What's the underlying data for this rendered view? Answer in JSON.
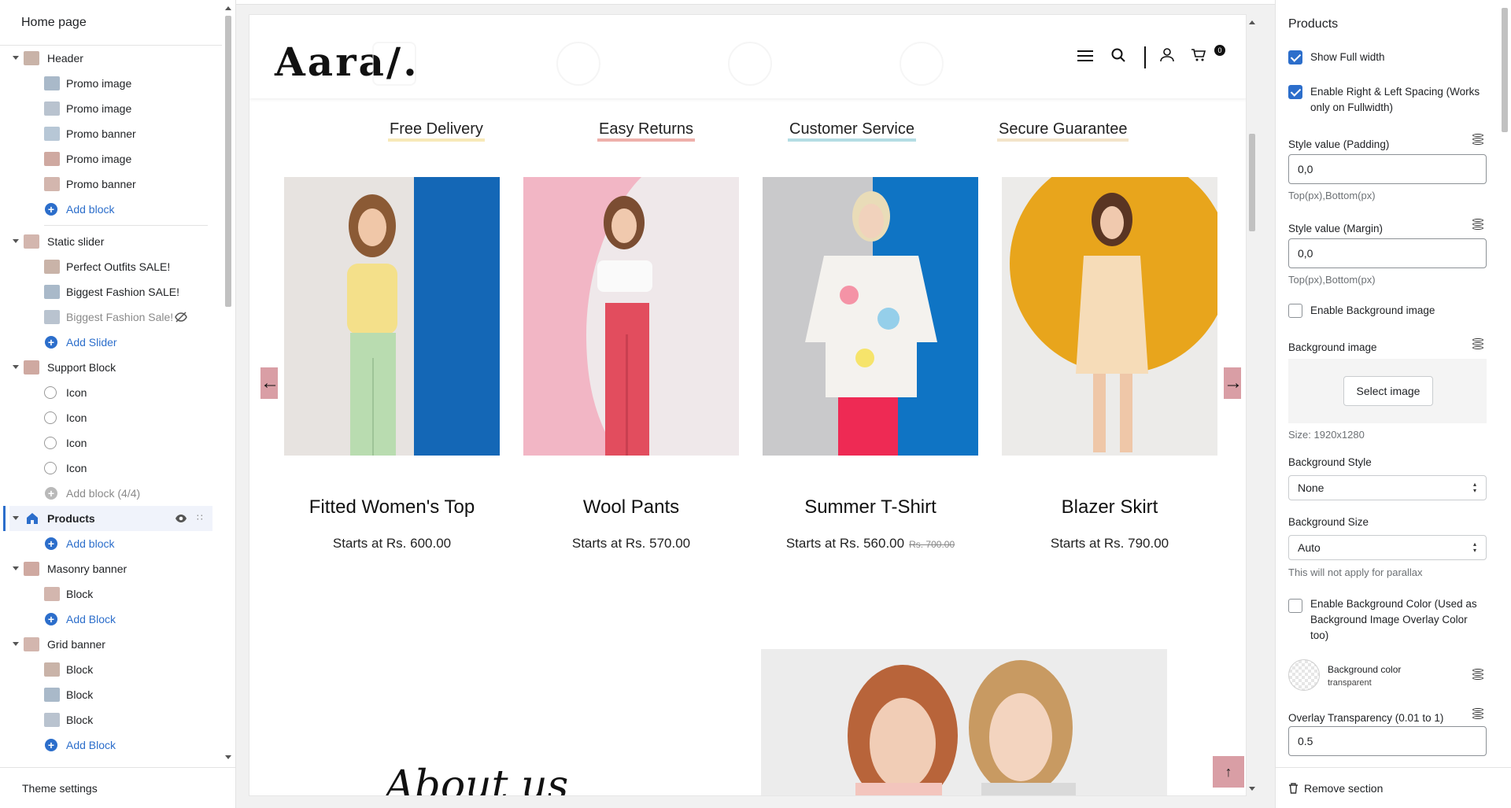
{
  "left_panel": {
    "title": "Home page",
    "footer": "Theme settings",
    "tree": [
      {
        "label": "Header",
        "type": "section"
      },
      {
        "label": "Promo image",
        "type": "child"
      },
      {
        "label": "Promo image",
        "type": "child"
      },
      {
        "label": "Promo banner",
        "type": "child"
      },
      {
        "label": "Promo image",
        "type": "child"
      },
      {
        "label": "Promo banner",
        "type": "child"
      },
      {
        "label": "Add block",
        "type": "add"
      },
      {
        "label": "Static slider",
        "type": "section"
      },
      {
        "label": "Perfect Outfits SALE!",
        "type": "child"
      },
      {
        "label": "Biggest Fashion SALE!",
        "type": "child"
      },
      {
        "label": "Biggest Fashion Sale!",
        "type": "child-hidden"
      },
      {
        "label": "Add Slider",
        "type": "add"
      },
      {
        "label": "Support Block",
        "type": "section"
      },
      {
        "label": "Icon",
        "type": "child"
      },
      {
        "label": "Icon",
        "type": "child"
      },
      {
        "label": "Icon",
        "type": "child"
      },
      {
        "label": "Icon",
        "type": "child"
      },
      {
        "label": "Add block (4/4)",
        "type": "add-disabled"
      },
      {
        "label": "Products",
        "type": "section-selected"
      },
      {
        "label": "Add block",
        "type": "add"
      },
      {
        "label": "Masonry banner",
        "type": "section"
      },
      {
        "label": "Block",
        "type": "child"
      },
      {
        "label": "Add Block",
        "type": "add"
      },
      {
        "label": "Grid banner",
        "type": "section"
      },
      {
        "label": "Block",
        "type": "child"
      },
      {
        "label": "Block",
        "type": "child"
      },
      {
        "label": "Block",
        "type": "child"
      },
      {
        "label": "Add Block",
        "type": "add"
      }
    ]
  },
  "preview": {
    "logo": "Aara/.",
    "cart_count": "0",
    "features": [
      {
        "label": "Free Delivery",
        "underline": "#f7e9b8"
      },
      {
        "label": "Easy Returns",
        "underline": "#eeb0aa"
      },
      {
        "label": "Customer Service",
        "underline": "#b4dde4"
      },
      {
        "label": "Secure Guarantee",
        "underline": "#f3e4c9"
      }
    ],
    "products": [
      {
        "name": "Fitted Women's Top",
        "price": "Starts at Rs. 600.00",
        "compare": ""
      },
      {
        "name": "Wool Pants",
        "price": "Starts at Rs. 570.00",
        "compare": ""
      },
      {
        "name": "Summer T-Shirt",
        "price": "Starts at Rs. 560.00",
        "compare": "Rs. 700.00"
      },
      {
        "name": "Blazer Skirt",
        "price": "Starts at Rs. 790.00",
        "compare": ""
      }
    ],
    "about_heading": "About us",
    "accent": "#d99ea5"
  },
  "right_panel": {
    "title": "Products",
    "show_full_width": {
      "label": "Show Full width",
      "checked": true
    },
    "enable_spacing": {
      "label": "Enable Right & Left Spacing (Works only on Fullwidth)",
      "checked": true
    },
    "padding": {
      "label": "Style value (Padding)",
      "value": "0,0",
      "help": "Top(px),Bottom(px)"
    },
    "margin": {
      "label": "Style value (Margin)",
      "value": "0,0",
      "help": "Top(px),Bottom(px)"
    },
    "enable_bg_image": {
      "label": "Enable Background image",
      "checked": false
    },
    "bg_image": {
      "label": "Background image",
      "button": "Select image",
      "size": "Size: 1920x1280"
    },
    "bg_style": {
      "label": "Background Style",
      "value": "None"
    },
    "bg_size": {
      "label": "Background Size",
      "value": "Auto",
      "help": "This will not apply for parallax"
    },
    "enable_bg_color": {
      "label": "Enable Background Color (Used as Background Image Overlay Color too)",
      "checked": false
    },
    "bg_color": {
      "label": "Background color",
      "value": "transparent"
    },
    "overlay": {
      "label": "Overlay Transparency (0.01 to 1)",
      "value": "0.5"
    },
    "remove": "Remove section"
  },
  "icons": [
    "caret-down-icon",
    "eye-icon",
    "drag-handle-icon",
    "eye-off-icon",
    "menu-icon",
    "search-icon",
    "user-icon",
    "cart-icon",
    "arrow-left-icon",
    "arrow-right-icon",
    "arrow-up-icon",
    "database-icon",
    "trash-icon"
  ]
}
